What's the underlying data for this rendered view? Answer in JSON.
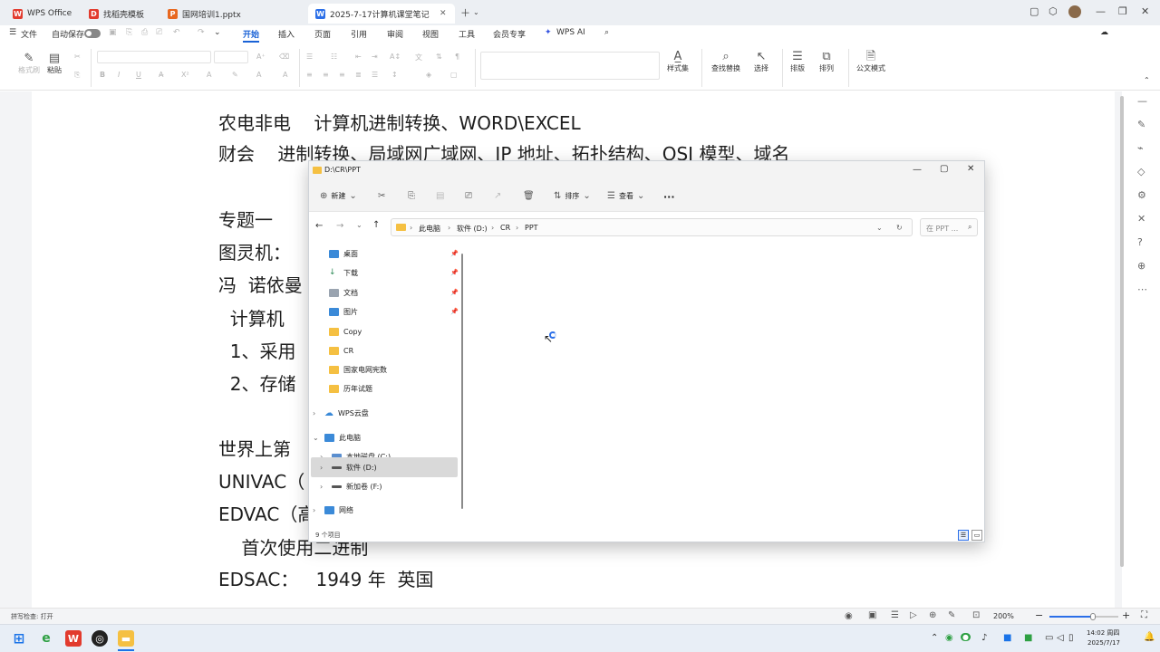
{
  "tabs": [
    {
      "label": "WPS Office",
      "icon": "wps-logo-icon",
      "color": "#e23b2e"
    },
    {
      "label": "找稻壳模板",
      "icon": "docer-icon",
      "color": "#e23b2e"
    },
    {
      "label": "国网培训1.pptx",
      "icon": "ppt-icon",
      "color": "#e8681f"
    },
    {
      "label": "2025-7-17计算机课堂笔记.dc",
      "icon": "word-icon",
      "color": "#2b6fe8"
    }
  ],
  "menus": {
    "file": "文件",
    "autosave": "自动保存",
    "items": [
      "开始",
      "插入",
      "页面",
      "引用",
      "审阅",
      "视图",
      "工具",
      "会员专享",
      "WPS AI"
    ],
    "active": "开始",
    "share": "分享"
  },
  "ribbon": {
    "format_painter": "格式刷",
    "paste": "粘贴",
    "style_set": "样式集",
    "find_replace": "查找替换",
    "select": "选择",
    "typeset": "排版",
    "arrange": "排列",
    "official_mode": "公文模式"
  },
  "document": {
    "lines": [
      "农电非电    计算机进制转换、WORD\\EXCEL",
      "财会    进制转换、局域网广域网、IP 地址、拓扑结构、OSI 模型、域名",
      "专题一",
      "图灵机：",
      "冯  诺依曼",
      "  计算机",
      "  1、采用",
      "  2、存储",
      "世界上第",
      "UNIVAC（",
      "EDVAC（高",
      "    首次使用二进制",
      "EDSAC：   1949 年  英国"
    ]
  },
  "explorer": {
    "title": "D:\\CR\\PPT",
    "toolbar": {
      "new": "新建",
      "sort": "排序",
      "view": "查看",
      "more": "···"
    },
    "breadcrumb": [
      "此电脑",
      "软件 (D:)",
      "CR",
      "PPT"
    ],
    "search_placeholder": "在 PPT ...",
    "nav": [
      {
        "label": "桌面",
        "icon": "desktop-icon",
        "pinned": true
      },
      {
        "label": "下载",
        "icon": "download-icon",
        "pinned": true
      },
      {
        "label": "文档",
        "icon": "documents-icon",
        "pinned": true
      },
      {
        "label": "图片",
        "icon": "pictures-icon",
        "pinned": true
      },
      {
        "label": "Copy",
        "icon": "folder-icon",
        "pinned": false
      },
      {
        "label": "CR",
        "icon": "folder-icon",
        "pinned": false
      },
      {
        "label": "国家电网宪数",
        "icon": "folder-icon",
        "pinned": false
      },
      {
        "label": "历年试题",
        "icon": "folder-icon",
        "pinned": false
      },
      {
        "label": "WPS云盘",
        "icon": "cloud-icon",
        "pinned": false
      },
      {
        "label": "此电脑",
        "icon": "computer-icon",
        "pinned": false
      },
      {
        "label": "本地磁盘 (C:)",
        "icon": "drive-icon",
        "pinned": false
      },
      {
        "label": "软件 (D:)",
        "icon": "drive-icon",
        "pinned": false
      },
      {
        "label": "新加卷 (F:)",
        "icon": "drive-icon",
        "pinned": false
      },
      {
        "label": "网络",
        "icon": "network-icon",
        "pinned": false
      }
    ],
    "selected_nav": "软件 (D:)",
    "status": "9 个项目"
  },
  "statusbar": {
    "spellcheck": "拼写检查: 打开",
    "zoom": "200%"
  },
  "taskbar": {
    "time": "14:02 周四",
    "date": "2025/7/17"
  }
}
